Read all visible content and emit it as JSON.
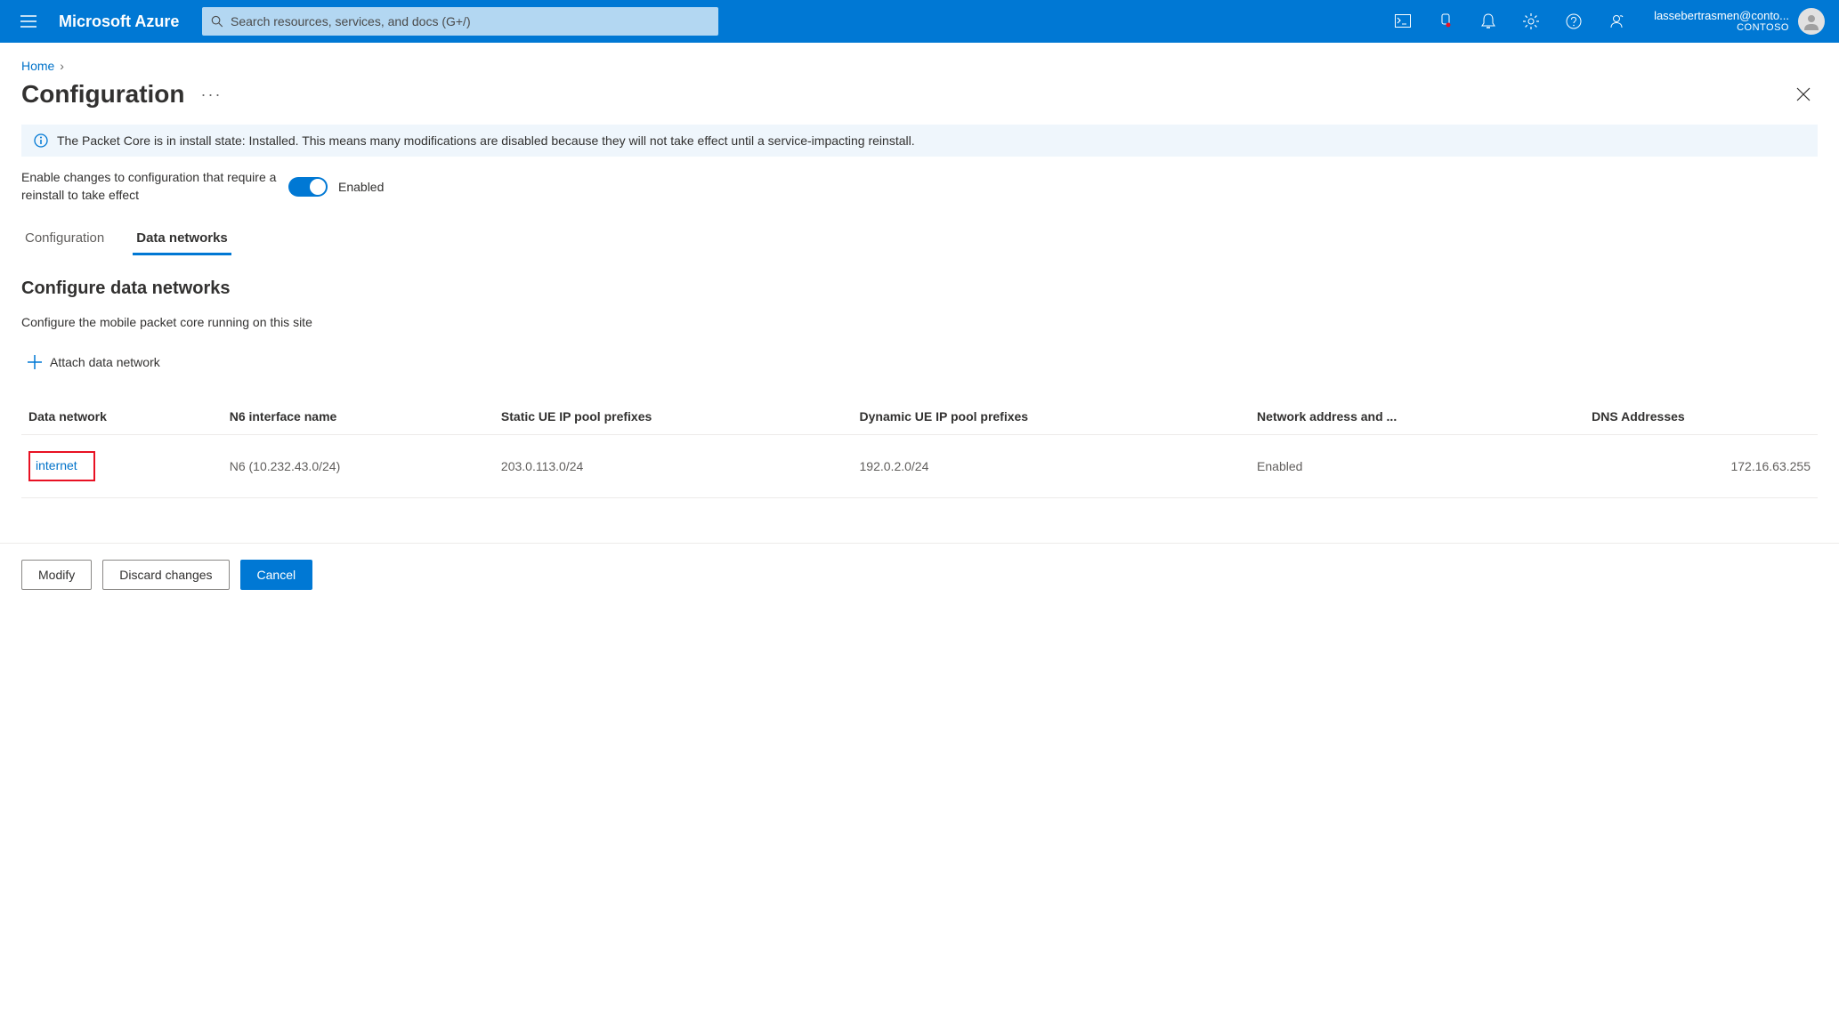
{
  "header": {
    "brand": "Microsoft Azure",
    "search_placeholder": "Search resources, services, and docs (G+/)",
    "account_email": "lassebertrasmen@conto...",
    "account_tenant": "CONTOSO"
  },
  "breadcrumb": {
    "items": [
      "Home"
    ]
  },
  "page": {
    "title": "Configuration"
  },
  "banner": {
    "message": "The Packet Core is in install state: Installed. This means many modifications are disabled because they will not take effect until a service-impacting reinstall."
  },
  "enable": {
    "label": "Enable changes to configuration that require a reinstall to take effect",
    "state": "Enabled"
  },
  "tabs": [
    {
      "label": "Configuration",
      "active": false
    },
    {
      "label": "Data networks",
      "active": true
    }
  ],
  "section": {
    "title": "Configure data networks",
    "desc": "Configure the mobile packet core running on this site",
    "attach_label": "Attach data network"
  },
  "table": {
    "columns": [
      "Data network",
      "N6 interface name",
      "Static UE IP pool prefixes",
      "Dynamic UE IP pool prefixes",
      "Network address and ...",
      "DNS Addresses"
    ],
    "rows": [
      {
        "name": "internet",
        "n6": "N6 (10.232.43.0/24)",
        "static_prefix": "203.0.113.0/24",
        "dynamic_prefix": "192.0.2.0/24",
        "nat": "Enabled",
        "dns": "172.16.63.255"
      }
    ]
  },
  "footer": {
    "modify": "Modify",
    "discard": "Discard changes",
    "cancel": "Cancel"
  }
}
